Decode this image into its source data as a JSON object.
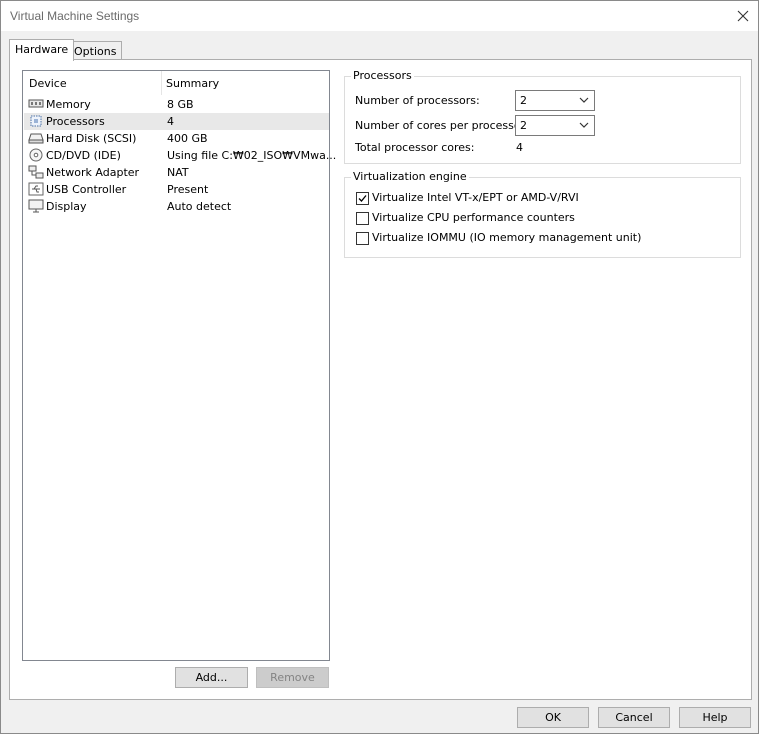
{
  "window": {
    "title": "Virtual Machine Settings"
  },
  "tabs": [
    {
      "label": "Hardware",
      "active": true
    },
    {
      "label": "Options",
      "active": false
    }
  ],
  "device_list": {
    "columns": [
      "Device",
      "Summary"
    ],
    "rows": [
      {
        "device": "Memory",
        "summary": "8 GB",
        "icon": "memory-icon"
      },
      {
        "device": "Processors",
        "summary": "4",
        "icon": "processor-icon",
        "selected": true
      },
      {
        "device": "Hard Disk (SCSI)",
        "summary": "400 GB",
        "icon": "hard-disk-icon"
      },
      {
        "device": "CD/DVD (IDE)",
        "summary": "Using file C:₩02_ISO₩VMwa...",
        "icon": "cd-dvd-icon"
      },
      {
        "device": "Network Adapter",
        "summary": "NAT",
        "icon": "network-adapter-icon"
      },
      {
        "device": "USB Controller",
        "summary": "Present",
        "icon": "usb-icon"
      },
      {
        "device": "Display",
        "summary": "Auto detect",
        "icon": "display-icon"
      }
    ]
  },
  "list_buttons": {
    "add": "Add...",
    "remove": "Remove"
  },
  "processors": {
    "group_title": "Processors",
    "num_processors_label": "Number of processors:",
    "num_processors_value": "2",
    "cores_label": "Number of cores per processor:",
    "cores_value": "2",
    "total_label": "Total processor cores:",
    "total_value": "4"
  },
  "virtualization": {
    "group_title": "Virtualization engine",
    "options": [
      {
        "label": "Virtualize Intel VT-x/EPT or AMD-V/RVI",
        "checked": true
      },
      {
        "label": "Virtualize CPU performance counters",
        "checked": false
      },
      {
        "label": "Virtualize IOMMU (IO memory management unit)",
        "checked": false
      }
    ]
  },
  "footer": {
    "ok": "OK",
    "cancel": "Cancel",
    "help": "Help"
  }
}
